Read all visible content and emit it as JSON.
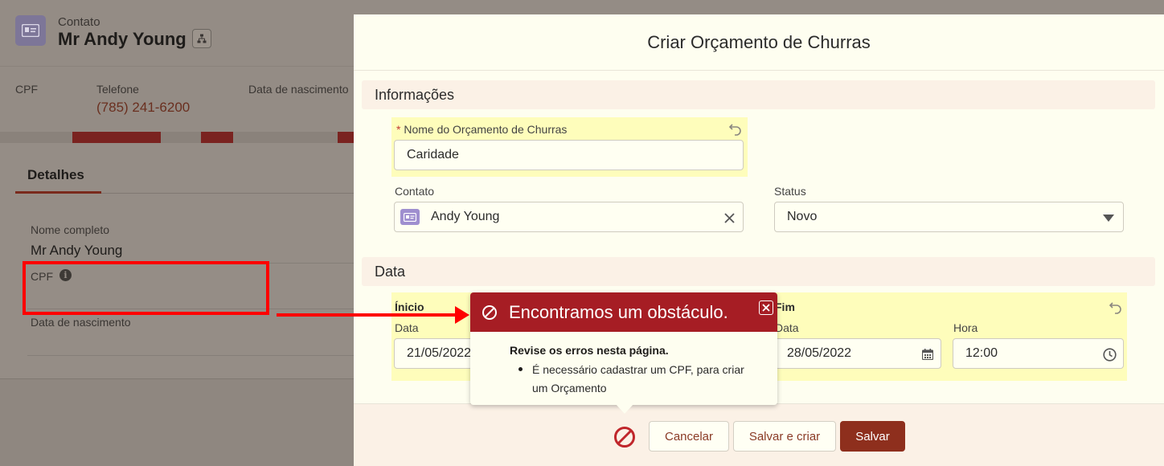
{
  "record": {
    "object_label": "Contato",
    "name": "Mr Andy Young",
    "highlights": {
      "cpf_label": "CPF",
      "phone_label": "Telefone",
      "phone_value": "(785) 241-6200",
      "birth_label": "Data de nascimento"
    },
    "tab": "Detalhes",
    "fields": {
      "full_name_label": "Nome completo",
      "full_name_value": "Mr Andy Young",
      "cpf_label": "CPF",
      "birth_label": "Data de nascimento"
    }
  },
  "modal": {
    "title": "Criar Orçamento de Churras",
    "section_info": "Informações",
    "name_field": {
      "required_mark": "*",
      "label": "Nome do Orçamento de Churras",
      "value": "Caridade"
    },
    "contact_field": {
      "label": "Contato",
      "value": "Andy Young"
    },
    "status_field": {
      "label": "Status",
      "value": "Novo"
    },
    "section_date": "Data",
    "inicio": {
      "group_label": "Ínicio",
      "date_label": "Data",
      "date_value": "21/05/2022"
    },
    "fim": {
      "group_label": "Fim",
      "date_label": "Data",
      "date_value": "28/05/2022",
      "time_label": "Hora",
      "time_value": "12:00"
    },
    "footer": {
      "cancel": "Cancelar",
      "save_new": "Salvar e criar",
      "save": "Salvar"
    }
  },
  "error_popover": {
    "title": "Encontramos um obstáculo.",
    "body_title": "Revise os erros nesta página.",
    "message_line1": "É necessário cadastrar um CPF, para criar",
    "message_line2": "um Orçamento"
  },
  "colors": {
    "brand": "#8e2f1d",
    "error_header": "#a61d24",
    "annotation": "#ff0000",
    "field_highlight": "#fefdbb"
  },
  "icons": [
    "contact-card-icon",
    "hierarchy-icon",
    "info-icon",
    "undo-icon",
    "clear-icon",
    "dropdown-arrow-icon",
    "calendar-icon",
    "clock-icon",
    "error-circle-icon",
    "close-icon"
  ]
}
